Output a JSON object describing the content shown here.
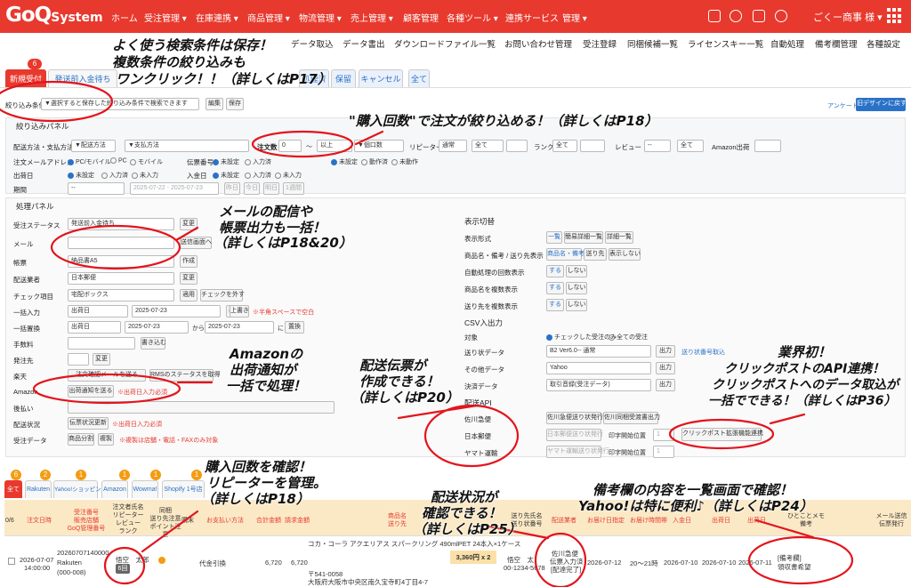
{
  "nav": {
    "logo": "GoQ",
    "logo_sub": "System",
    "logo_ruby": "ゴーク",
    "items": [
      "ホーム",
      "受注管理 ▾",
      "在庫連携 ▾",
      "商品管理 ▾",
      "物流管理 ▾",
      "売上管理 ▾",
      "顧客管理",
      "各種ツール ▾",
      "連携サービス",
      "管理 ▾"
    ],
    "company": "ごくー商事 様 ▾"
  },
  "subnav": [
    "データ取込",
    "データ書出",
    "ダウンロードファイル一覧",
    "お問い合わせ管理",
    "受注登録",
    "同梱候補一覧",
    "ライセンスキー一覧",
    "自動処理",
    "備考欄管理",
    "各種設定"
  ],
  "tabs": {
    "new": "新規受付",
    "new_count": "6",
    "waiting": "発送前入金待ち",
    "done": "処理済",
    "hold": "保留",
    "cancel": "キャンセル",
    "all": "全て"
  },
  "filter": {
    "label": "絞り込み条件",
    "select": "▼選択すると保存した絞り込み条件で検索できます",
    "edit": "編集",
    "save": "保存",
    "survey": "アンケート",
    "old_design": "旧デザインに戻す"
  },
  "search": {
    "title": "絞り込みパネル",
    "row1": {
      "label": "配送方法・支払方法",
      "delivery": "▼配送方法",
      "payment": "▼支払方法",
      "count_label": "注文数",
      "count_val": "0",
      "tilde": "〜",
      "count_op": "以上",
      "count_kind": "▼個口数",
      "repeater": "リピーター",
      "repeater_v": "通常",
      "all": "全て",
      "rank": "ランク",
      "rank_v": "全て",
      "review": "レビュー",
      "review_v": "--",
      "all2": "全て",
      "amazon": "Amazon出荷"
    },
    "row2": {
      "label": "注文メールアドレス",
      "pc_mobile": "PC/モバイル",
      "pc": "PC",
      "mobile": "モバイル",
      "slip": "伝票番号",
      "unset": "未設定",
      "input_done": "入力済",
      "ship_unset": "未設定",
      "moving": "動作済",
      "not_done": "未動作"
    },
    "row3": {
      "label": "出荷日",
      "unset": "未設定",
      "entered": "入力済",
      "not_entered": "未入力",
      "pay_label": "入金日",
      "pay_unset": "未設定",
      "pay_entered": "入力済",
      "pay_not": "未入力"
    },
    "row4": {
      "label": "期間",
      "sel": "--",
      "range": "2025-07-22 - 2025-07-23",
      "today": "昨日",
      "tomorrow": "今日",
      "week": "明日",
      "d": "1週間"
    }
  },
  "process": {
    "title": "処理パネル",
    "status": "受注ステータス",
    "status_v": "発送前入金待ち",
    "change": "変更",
    "mail": "メール",
    "send_page": "送信画面へ",
    "form": "帳票",
    "form_v": "納品書A5",
    "create": "作成",
    "carrier": "配送業者",
    "carrier_v": "日本郵便",
    "check": "チェック項目",
    "check_v": "宅配ボックス",
    "apply": "適用",
    "uncheck": "チェックを外す",
    "bulk_in": "一括入力",
    "ship_date": "出荷日",
    "date1": "2025-07-23",
    "apply2": "適用",
    "overwrite": "上書き",
    "space_note": "※半角スペースで空白",
    "bulk_rep": "一括置換",
    "ship_date2": "出荷日",
    "from": "2025-07-23",
    "to_word": "から",
    "to": "2025-07-23",
    "ni": "に",
    "replace": "置換",
    "fee": "手数料",
    "write": "書き込む",
    "sender": "発注先",
    "change2": "変更",
    "rakuten": "楽天",
    "rakuten_b1": "注文確認メールを送る",
    "rakuten_b2": "RMSのステータスを取得",
    "amazon": "Amazon",
    "amazon_b": "出荷通知を送る",
    "amazon_note": "※出荷日入力必須",
    "later": "後払い",
    "ship_status": "配送状況",
    "ship_b": "伝票状況更新",
    "ship_note": "※出荷日入力必須",
    "order_data": "受注データ",
    "split": "商品分割",
    "copy": "複製",
    "copy_note": "※複製は店舗・電話・FAXのみ対象"
  },
  "display": {
    "title": "表示切替",
    "form": "表示形式",
    "list": "一覧",
    "simple": "簡易詳細一覧",
    "detail": "詳細一覧",
    "name_dest": "商品名・備考 / 送り先表示",
    "name_memo": "商品名・備考",
    "dest": "送り先",
    "no_show": "表示しない",
    "auto_count": "自動処理の回数表示",
    "do": "する",
    "dont": "しない",
    "multi_name": "商品名を複数表示",
    "multi_dest": "送り先を複数表示"
  },
  "csv": {
    "title": "CSV入出力",
    "target": "対象",
    "checked_only": "チェックした受注のみ",
    "all_orders": "全ての受注",
    "slip_data": "送り状データ",
    "slip_v": "B2 Ver6.0-- 通常",
    "output": "出力",
    "slip_link": "送り状番号取込",
    "other": "その他データ",
    "other_v": "Yahoo",
    "settle": "決済データ",
    "settle_v": "取引音録(受注データ)"
  },
  "api": {
    "title": "配送API",
    "sagawa": "佐川急便",
    "sagawa_b1": "佐川急便送り状発行",
    "sagawa_b2": "佐川同梱受渡書出力",
    "japanpost": "日本郵便",
    "jp_b1": "日本郵便送り状発行",
    "print_pos": "印字開始位置",
    "pos_v": "1",
    "clickpost": "クリックポスト拡張機能連携",
    "yamato": "ヤマト運輸",
    "ym_b1": "ヤマト運輸送り状発行",
    "print_pos2": "印字開始位置",
    "pos_v2": "1"
  },
  "stores": {
    "all": "全て",
    "all_count": "6",
    "rakuten": "Rakuten",
    "rakuten_c": "2",
    "yahoo": "Yahoo!ショッピング",
    "yahoo_c": "1",
    "amazon": "Amazon",
    "amazon_c": "1",
    "wowma": "Wowma!",
    "wowma_c": "1",
    "shopify": "Shopify 1号店",
    "shopify_c": "1"
  },
  "table": {
    "headers": [
      "0/6",
      "注文日時",
      "受注番号\n販売店舗\nGoQ管理番号",
      "注文者氏名\nリピーター\nレビュー\nランク",
      "同梱\n送り先注意\nポイント注意",
      "購末",
      "お支払い方法",
      "合計金額",
      "請求金額",
      "商品名\n送り先",
      "送り先氏名\n送り状番号",
      "配送業者",
      "お届け日指定",
      "お届け時間帯",
      "入金日",
      "出荷日",
      "出荷日",
      "ひとことメモ\n備考",
      "メール送信\n伝票発行"
    ],
    "row": {
      "date": "2026-07-07",
      "time": "14:00:00",
      "order_no": "20260707140000",
      "store": "Rakuten",
      "goq_no": "(000-008)",
      "name": "悟空　太郎",
      "repeat": "6回",
      "pay": "代金引換",
      "total": "6,720",
      "bill": "6,720",
      "product": "コカ・コーラ アクエリアス スパークリング 490mlPET 24本入×1ケース",
      "price": "3,360円 x 2",
      "zip": "〒541-0058",
      "address": "大阪府大阪市中央区南久宝寺町4丁目4-7",
      "dest_name": "悟空　太",
      "slip_no": "00-1234-5678",
      "carrier": "佐川急便",
      "carrier_s": "伝票入力済",
      "carrier_s2": "[配達完了]",
      "deliver": "2026-07-12",
      "timeband": "20〜21時",
      "pay_date": "2026-07-10",
      "ship": "2026-07-10",
      "ship2": "2026-07-11",
      "memo": "[備考欄]",
      "memo2": "領収書希望"
    }
  },
  "annotations": {
    "a1": "よく使う検索条件は保存！",
    "a2": "複数条件の絞り込みも",
    "a3": "ワンクリック！！（詳しくはP17）",
    "a4": "\"購入回数\"で注文が絞り込める！（詳しくはP18）",
    "a5": "メールの配信や",
    "a6": "帳票出力も一括！",
    "a7": "（詳しくはP18&20）",
    "a8": "Amazonの",
    "a9": "出荷通知が",
    "a10": "一括で処理！",
    "a11": "配送伝票が",
    "a12": "作成できる！",
    "a13": "（詳しくはP20）",
    "a14": "業界初！",
    "a15": "クリックポストのAPI連携！",
    "a16": "クリックポストへのデータ取込が",
    "a17": "一括でできる！（詳しくはP36）",
    "a18": "購入回数を確認！",
    "a19": "リピーターを管理。",
    "a20": "（詳しくはP18）",
    "a21": "配送状況が",
    "a22": "確認できる！",
    "a23": "（詳しくはP25）",
    "a24": "備考欄の内容を一覧画面で確認！",
    "a25": "Yahoo!は特に便利♪（詳しくはP24）"
  }
}
